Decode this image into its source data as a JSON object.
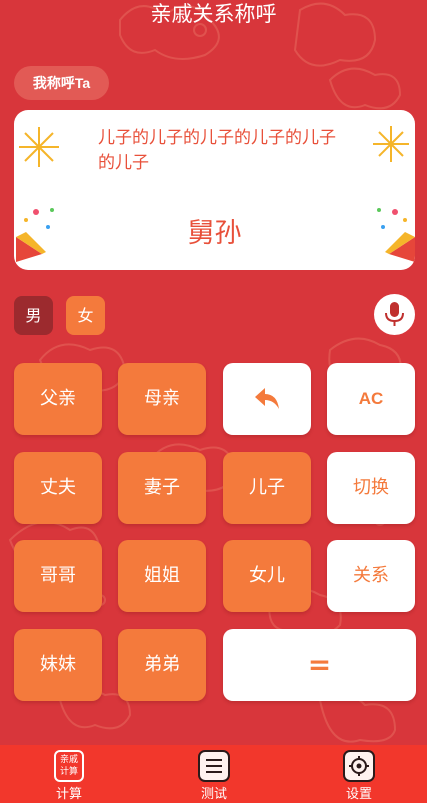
{
  "header": {
    "title": "亲戚关系称呼"
  },
  "mode": {
    "label": "我称呼Ta"
  },
  "display": {
    "expression": "儿子的儿子的儿子的儿子的儿子的儿子",
    "result": "舅孙"
  },
  "gender": {
    "male": "男",
    "female": "女"
  },
  "keys": {
    "father": "父亲",
    "mother": "母亲",
    "ac": "AC",
    "husband": "丈夫",
    "wife": "妻子",
    "son": "儿子",
    "switch": "切换",
    "elder_brother": "哥哥",
    "elder_sister": "姐姐",
    "daughter": "女儿",
    "relation": "关系",
    "younger_sister": "妹妹",
    "younger_brother": "弟弟",
    "equals": "="
  },
  "tabbar": {
    "calc_icon_text": "亲戚计算",
    "calc": "计算",
    "test": "测试",
    "settings": "设置"
  },
  "colors": {
    "background": "#d8363b",
    "accent_orange": "#f47a3c",
    "tabbar": "#f2372c",
    "text_red": "#e8503a"
  },
  "icons": {
    "backspace": "backspace-arrow-icon",
    "mic": "microphone-icon",
    "test": "list-icon",
    "settings": "gear-icon"
  }
}
